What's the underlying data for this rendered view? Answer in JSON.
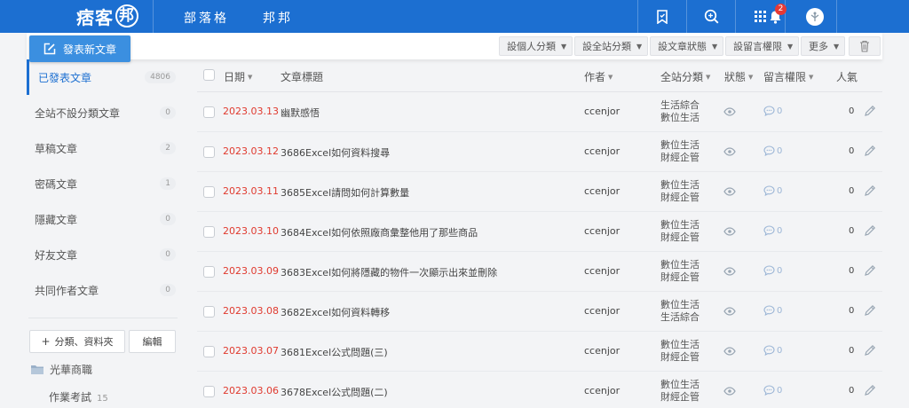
{
  "topbar": {
    "logo_main": "痞客",
    "logo_badge": "邦",
    "nav": [
      "部落格",
      "邦邦"
    ],
    "notification_count": "2",
    "icons": [
      "bookmark-icon",
      "search-icon",
      "apps-grid-icon",
      "bell-icon",
      "avatar"
    ]
  },
  "actions": {
    "post_button": "發表新文章",
    "dropdowns": [
      "設個人分類",
      "設全站分類",
      "設文章狀態",
      "設留言權限",
      "更多"
    ]
  },
  "sidebar": {
    "items": [
      {
        "label": "已發表文章",
        "count": "4806",
        "active": true
      },
      {
        "label": "全站不設分類文章",
        "count": "0",
        "active": false
      },
      {
        "label": "草稿文章",
        "count": "2",
        "active": false
      },
      {
        "label": "密碼文章",
        "count": "1",
        "active": false
      },
      {
        "label": "隱藏文章",
        "count": "0",
        "active": false
      },
      {
        "label": "好友文章",
        "count": "0",
        "active": false
      },
      {
        "label": "共同作者文章",
        "count": "0",
        "active": false
      }
    ],
    "category_button": "分類、資料夾",
    "edit_button": "編輯",
    "folder": "光華商職",
    "subfolder": {
      "label": "作業考試",
      "count": "15"
    }
  },
  "table": {
    "headers": {
      "date": "日期",
      "title": "文章標題",
      "author": "作者",
      "category": "全站分類",
      "status": "狀態",
      "comment": "留言權限",
      "popularity": "人氣"
    },
    "rows": [
      {
        "date": "2023.03.13",
        "title": "幽默感悟",
        "author": "ccenjor",
        "cat1": "生活綜合",
        "cat2": "數位生活",
        "comments": "0",
        "views": "0"
      },
      {
        "date": "2023.03.12",
        "title": "3686Excel如何資料搜尋",
        "author": "ccenjor",
        "cat1": "數位生活",
        "cat2": "財經企管",
        "comments": "0",
        "views": "0"
      },
      {
        "date": "2023.03.11",
        "title": "3685Excel請問如何計算數量",
        "author": "ccenjor",
        "cat1": "數位生活",
        "cat2": "財經企管",
        "comments": "0",
        "views": "0"
      },
      {
        "date": "2023.03.10",
        "title": "3684Excel如何依照廠商彙整他用了那些商品",
        "author": "ccenjor",
        "cat1": "數位生活",
        "cat2": "財經企管",
        "comments": "0",
        "views": "0"
      },
      {
        "date": "2023.03.09",
        "title": "3683Excel如何將隱藏的物件一次顯示出來並刪除",
        "author": "ccenjor",
        "cat1": "數位生活",
        "cat2": "財經企管",
        "comments": "0",
        "views": "0"
      },
      {
        "date": "2023.03.08",
        "title": "3682Excel如何資料轉移",
        "author": "ccenjor",
        "cat1": "數位生活",
        "cat2": "生活綜合",
        "comments": "0",
        "views": "0"
      },
      {
        "date": "2023.03.07",
        "title": "3681Excel公式問題(三)",
        "author": "ccenjor",
        "cat1": "數位生活",
        "cat2": "財經企管",
        "comments": "0",
        "views": "0"
      },
      {
        "date": "2023.03.06",
        "title": "3678Excel公式問題(二)",
        "author": "ccenjor",
        "cat1": "數位生活",
        "cat2": "財經企管",
        "comments": "0",
        "views": "0"
      }
    ]
  },
  "colors": {
    "topbar": "#1c6fd1",
    "post_button": "#3b8fe0",
    "date_red": "#e03a2f",
    "active_blue": "#1c6fd1"
  }
}
